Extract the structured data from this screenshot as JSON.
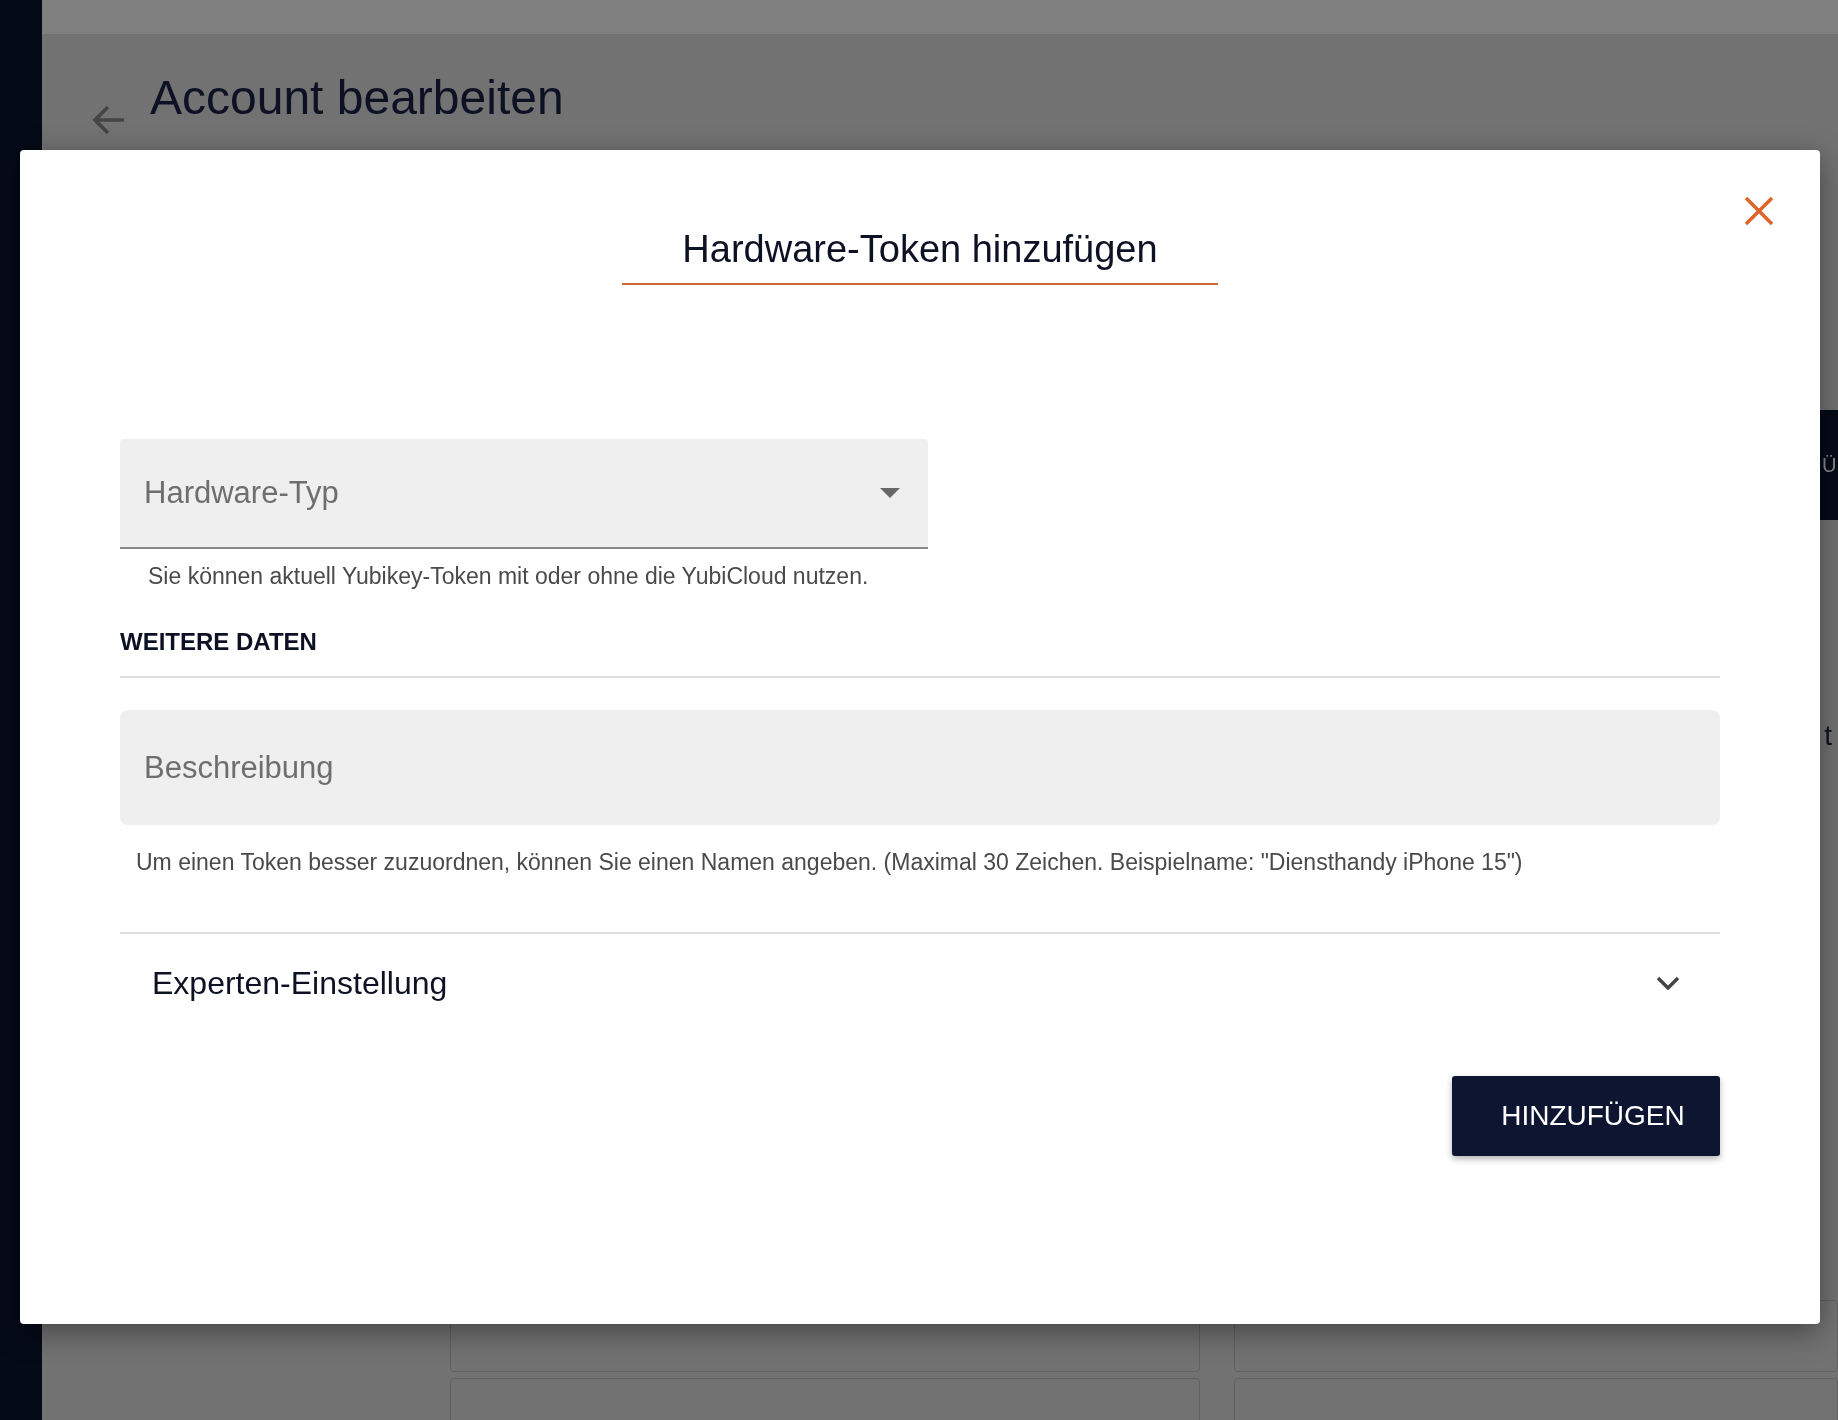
{
  "background_page": {
    "title": "Account bearbeiten",
    "side_button": "Ü",
    "side_text": "t"
  },
  "dialog": {
    "title": "Hardware-Token hinzufügen",
    "hardware_type": {
      "placeholder": "Hardware-Typ",
      "hint": "Sie können aktuell Yubikey-Token mit oder ohne die YubiCloud nutzen."
    },
    "section_title": "WEITERE DATEN",
    "description": {
      "placeholder": "Beschreibung",
      "hint": "Um einen Token besser zuzuordnen, können Sie einen Namen angeben. (Maximal 30 Zeichen. Beispielname: \"Diensthandy iPhone 15\")"
    },
    "expert_settings": {
      "label": "Experten-Einstellung",
      "expanded": false
    },
    "submit_button": "HINZUFÜGEN"
  }
}
